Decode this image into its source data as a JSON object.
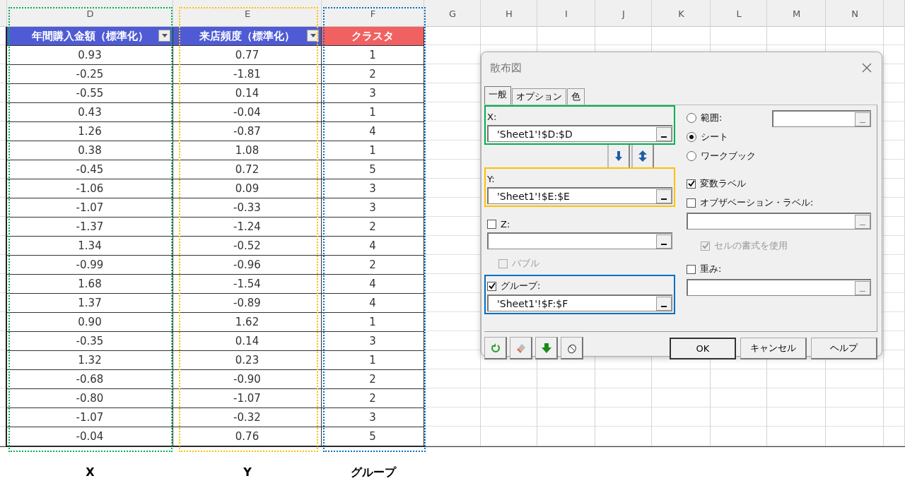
{
  "column_letters": [
    "D",
    "E",
    "F",
    "G",
    "H",
    "I",
    "J",
    "K",
    "L",
    "M",
    "N"
  ],
  "table": {
    "headers": [
      {
        "text": "年間購入金額（標準化）",
        "filter": true,
        "color": "#4f5bd5"
      },
      {
        "text": "来店頻度（標準化）",
        "filter": true,
        "color": "#4f5bd5"
      },
      {
        "text": "クラスタ",
        "filter": false,
        "color": "#f26161"
      }
    ],
    "rows": [
      [
        "0.93",
        "0.77",
        "1"
      ],
      [
        "-0.25",
        "-1.81",
        "2"
      ],
      [
        "-0.55",
        "0.14",
        "3"
      ],
      [
        "0.43",
        "-0.04",
        "1"
      ],
      [
        "1.26",
        "-0.87",
        "4"
      ],
      [
        "0.38",
        "1.08",
        "1"
      ],
      [
        "-0.45",
        "0.72",
        "5"
      ],
      [
        "-1.06",
        "0.09",
        "3"
      ],
      [
        "-1.07",
        "-0.33",
        "3"
      ],
      [
        "-1.37",
        "-1.24",
        "2"
      ],
      [
        "1.34",
        "-0.52",
        "4"
      ],
      [
        "-0.99",
        "-0.96",
        "2"
      ],
      [
        "1.68",
        "-1.54",
        "4"
      ],
      [
        "1.37",
        "-0.89",
        "4"
      ],
      [
        "0.90",
        "1.62",
        "1"
      ],
      [
        "-0.35",
        "0.14",
        "3"
      ],
      [
        "1.32",
        "0.23",
        "1"
      ],
      [
        "-0.68",
        "-0.90",
        "2"
      ],
      [
        "-0.80",
        "-1.07",
        "2"
      ],
      [
        "-1.07",
        "-0.32",
        "3"
      ],
      [
        "-0.04",
        "0.76",
        "5"
      ]
    ]
  },
  "annotations": [
    {
      "label": "X",
      "color": "#00b050"
    },
    {
      "label": "Y",
      "color": "#ffc000"
    },
    {
      "label": "グループ",
      "color": "#0070c0"
    }
  ],
  "dialog": {
    "title": "散布図",
    "tabs": [
      {
        "label": "一般",
        "selected": true
      },
      {
        "label": "オプション",
        "selected": false
      },
      {
        "label": "色",
        "selected": false
      }
    ],
    "left": [
      {
        "kind": "field",
        "label": "X:",
        "value": "'Sheet1'!$D:$D",
        "color": "#00b050"
      },
      {
        "kind": "swap"
      },
      {
        "kind": "field",
        "label": "Y:",
        "value": "'Sheet1'!$E:$E",
        "color": "#ffc000"
      },
      {
        "kind": "checkfield",
        "label": "Z:",
        "checked": false,
        "disabled": false
      },
      {
        "kind": "subcheck",
        "label": "バブル",
        "checked": false,
        "disabled": true
      },
      {
        "kind": "checkfield",
        "label": "グループ:",
        "checked": true,
        "disabled": false,
        "value": "'Sheet1'!$F:$F",
        "color": "#0070c0"
      }
    ],
    "right": [
      {
        "kind": "radio",
        "label": "範囲:",
        "selected": false,
        "field": true
      },
      {
        "kind": "radio",
        "label": "シート",
        "selected": true,
        "field": false
      },
      {
        "kind": "radio",
        "label": "ワークブック",
        "selected": false,
        "field": false
      },
      {
        "kind": "check",
        "label": "変数ラベル",
        "checked": true,
        "disabled": false,
        "field": false
      },
      {
        "kind": "check",
        "label": "オブザベーション・ラベル:",
        "checked": false,
        "disabled": false,
        "field": true
      },
      {
        "kind": "subcheck",
        "label": "セルの書式を使用",
        "checked": true,
        "disabled": true,
        "field": false
      },
      {
        "kind": "check",
        "label": "重み:",
        "checked": false,
        "disabled": false,
        "field": true
      }
    ],
    "buttons": [
      "OK",
      "キャンセル",
      "ヘルプ"
    ]
  }
}
